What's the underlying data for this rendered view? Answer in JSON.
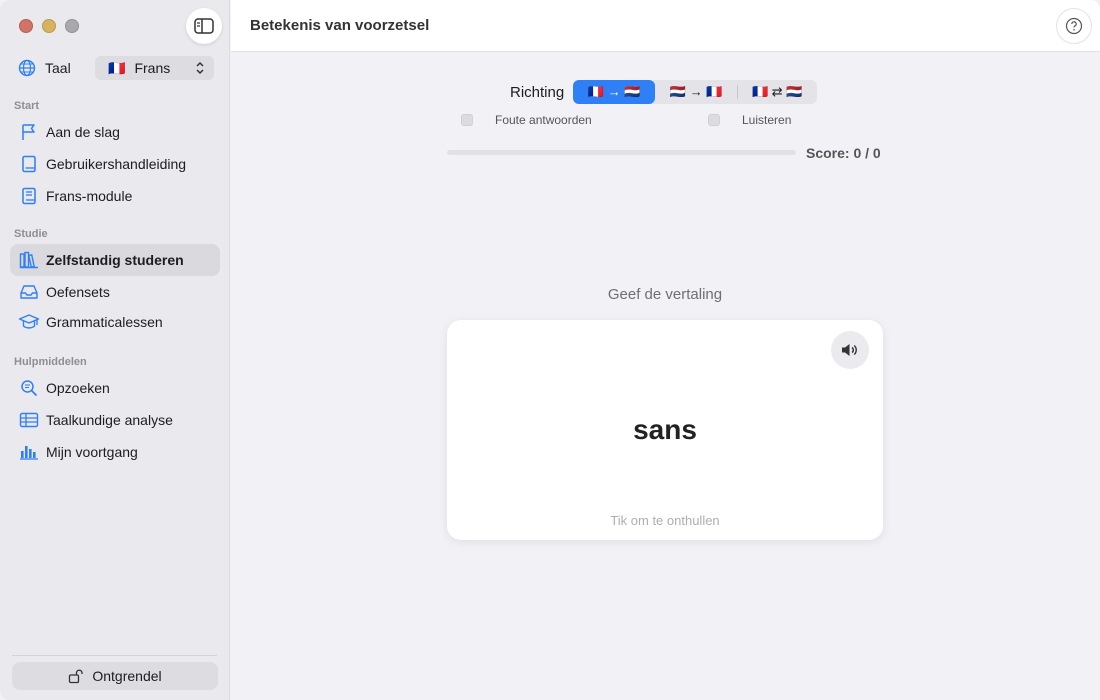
{
  "window": {
    "title": "Betekenis van voorzetsel"
  },
  "sidebar": {
    "language": {
      "label": "Taal",
      "flag": "🇫🇷",
      "selected": "Frans"
    },
    "sections": [
      {
        "title": "Start",
        "items": [
          {
            "label": "Aan de slag",
            "icon": "flag-icon"
          },
          {
            "label": "Gebruikershandleiding",
            "icon": "book-icon"
          },
          {
            "label": "Frans-module",
            "icon": "book-module-icon"
          }
        ]
      },
      {
        "title": "Studie",
        "items": [
          {
            "label": "Zelfstandig studeren",
            "icon": "books-icon",
            "active": true
          },
          {
            "label": "Oefensets",
            "icon": "tray-icon"
          },
          {
            "label": "Grammaticalessen",
            "icon": "graduation-cap-icon"
          }
        ]
      },
      {
        "title": "Hulpmiddelen",
        "items": [
          {
            "label": "Opzoeken",
            "icon": "magnifier-icon"
          },
          {
            "label": "Taalkundige analyse",
            "icon": "table-icon"
          },
          {
            "label": "Mijn voortgang",
            "icon": "bar-chart-icon"
          }
        ]
      }
    ],
    "unlock_label": "Ontgrendel"
  },
  "exercise": {
    "direction_label": "Richting",
    "directions": [
      {
        "label": "🇫🇷 → 🇳🇱",
        "selected": true
      },
      {
        "label": "🇳🇱 → 🇫🇷",
        "selected": false
      },
      {
        "label": "🇫🇷 ⇄ 🇳🇱",
        "selected": false
      }
    ],
    "options": [
      {
        "label": "Foute antwoorden",
        "checked": false
      },
      {
        "label": "Luisteren",
        "checked": false
      }
    ],
    "progress": 0,
    "score_text": "Score: 0 / 0",
    "prompt": "Geef de vertaling",
    "card_word": "sans",
    "card_hint": "Tik om te onthullen"
  },
  "colors": {
    "accent": "#2f7ff6",
    "sidebar_bg": "#e9e9ee",
    "main_bg": "#f2f2f6"
  }
}
